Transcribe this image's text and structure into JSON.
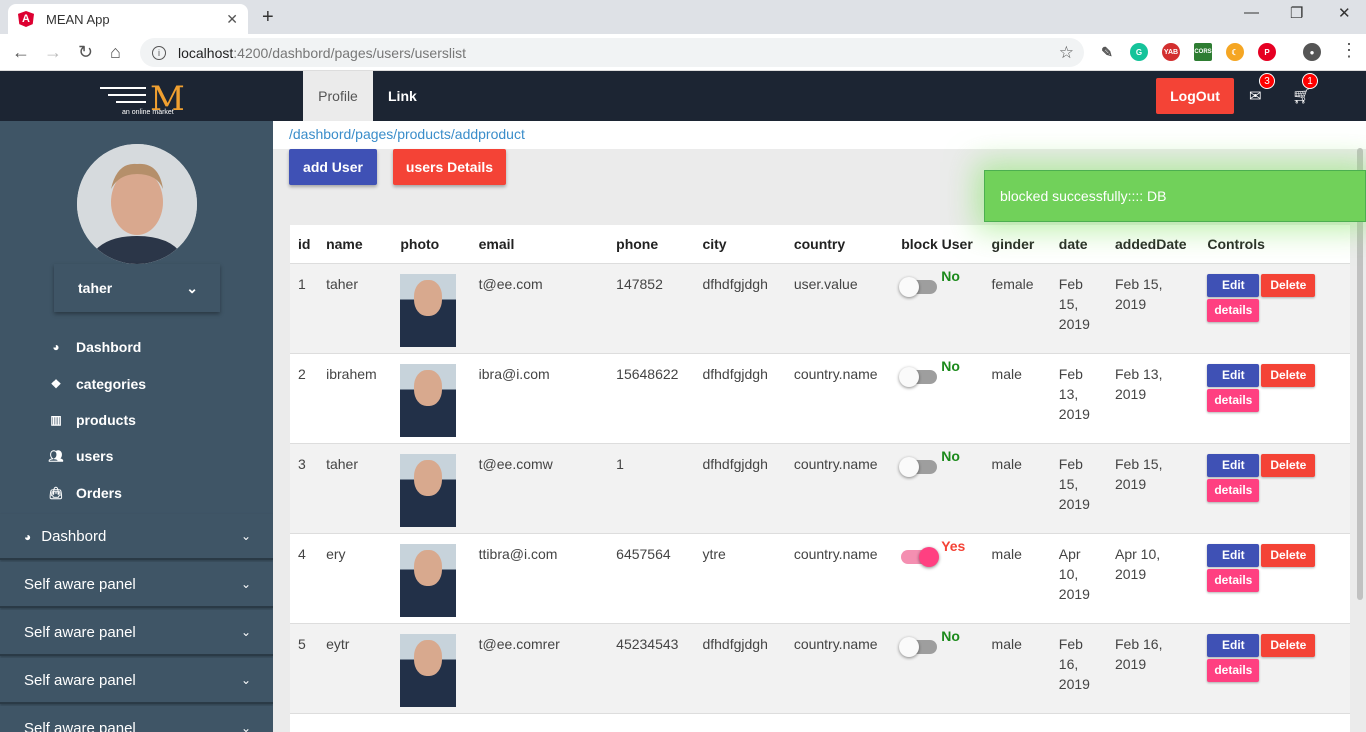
{
  "browser": {
    "tab_title": "MEAN App",
    "tab_favicon": "A",
    "url_host": "localhost",
    "url_path": ":4200/dashbord/pages/users/userslist",
    "extensions": [
      "eyedropper-icon",
      "grammarly-icon",
      "yab-icon",
      "cors-icon",
      "moon-icon",
      "pinterest-icon",
      "profile-avatar-icon"
    ]
  },
  "appbar": {
    "logo_sub": "an online market",
    "nav": [
      "Profile",
      "Link"
    ],
    "logout_label": "LogOut",
    "mail_count": "3",
    "cart_count": "1"
  },
  "sidebar": {
    "username": "taher",
    "menu": [
      "Dashbord",
      "categories",
      "products",
      "users",
      "Orders"
    ],
    "panels": [
      "Dashbord",
      "Self aware panel",
      "Self aware panel",
      "Self aware panel",
      "Self aware panel"
    ]
  },
  "main": {
    "breadcrumb": "/dashbord/pages/products/addproduct",
    "add_user_label": "add User",
    "users_details_label": "users Details",
    "columns": [
      "id",
      "name",
      "photo",
      "email",
      "phone",
      "city",
      "country",
      "block User",
      "ginder",
      "date",
      "addedDate",
      "Controls"
    ],
    "controls": {
      "edit": "Edit",
      "delete": "Delete",
      "details": "details"
    },
    "rows": [
      {
        "id": "1",
        "name": "taher",
        "email": "t@ee.com",
        "phone": "147852",
        "city": "dfhdfgjdgh",
        "country": "user.value",
        "blocked": false,
        "block_label": "No",
        "gender": "female",
        "date": "Feb 15, 2019",
        "added": "Feb 15, 2019"
      },
      {
        "id": "2",
        "name": "ibrahem",
        "email": "ibra@i.com",
        "phone": "15648622",
        "city": "dfhdfgjdgh",
        "country": "country.name",
        "blocked": false,
        "block_label": "No",
        "gender": "male",
        "date": "Feb 13, 2019",
        "added": "Feb 13, 2019"
      },
      {
        "id": "3",
        "name": "taher",
        "email": "t@ee.comw",
        "phone": "1",
        "city": "dfhdfgjdgh",
        "country": "country.name",
        "blocked": false,
        "block_label": "No",
        "gender": "male",
        "date": "Feb 15, 2019",
        "added": "Feb 15, 2019"
      },
      {
        "id": "4",
        "name": "ery",
        "email": "ttibra@i.com",
        "phone": "6457564",
        "city": "ytre",
        "country": "country.name",
        "blocked": true,
        "block_label": "Yes",
        "gender": "male",
        "date": "Apr 10, 2019",
        "added": "Apr 10, 2019"
      },
      {
        "id": "5",
        "name": "eytr",
        "email": "t@ee.comrer",
        "phone": "45234543",
        "city": "dfhdfgjdgh",
        "country": "country.name",
        "blocked": false,
        "block_label": "No",
        "gender": "male",
        "date": "Feb 16, 2019",
        "added": "Feb 16, 2019"
      }
    ]
  },
  "toast": {
    "message": "blocked successfully:::: DB"
  },
  "colors": {
    "appbar": "#1c2533",
    "sidebar": "#3f5566",
    "primary": "#3f51b5",
    "warn": "#f44336",
    "accent": "#ff4081",
    "success": "#71d15a"
  }
}
